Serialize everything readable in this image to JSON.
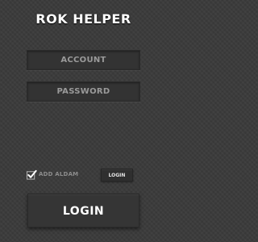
{
  "app": {
    "title": "ROK HELPER"
  },
  "form": {
    "account_placeholder": "ACCOUNT",
    "password_placeholder": "PASSWORD",
    "account_value": "",
    "password_value": ""
  },
  "remember": {
    "label": "ADD ALDAM",
    "checked": true,
    "icon": "checkmark-icon"
  },
  "buttons": {
    "small_login_label": "LOGIN",
    "login_label": "LOGIN"
  }
}
